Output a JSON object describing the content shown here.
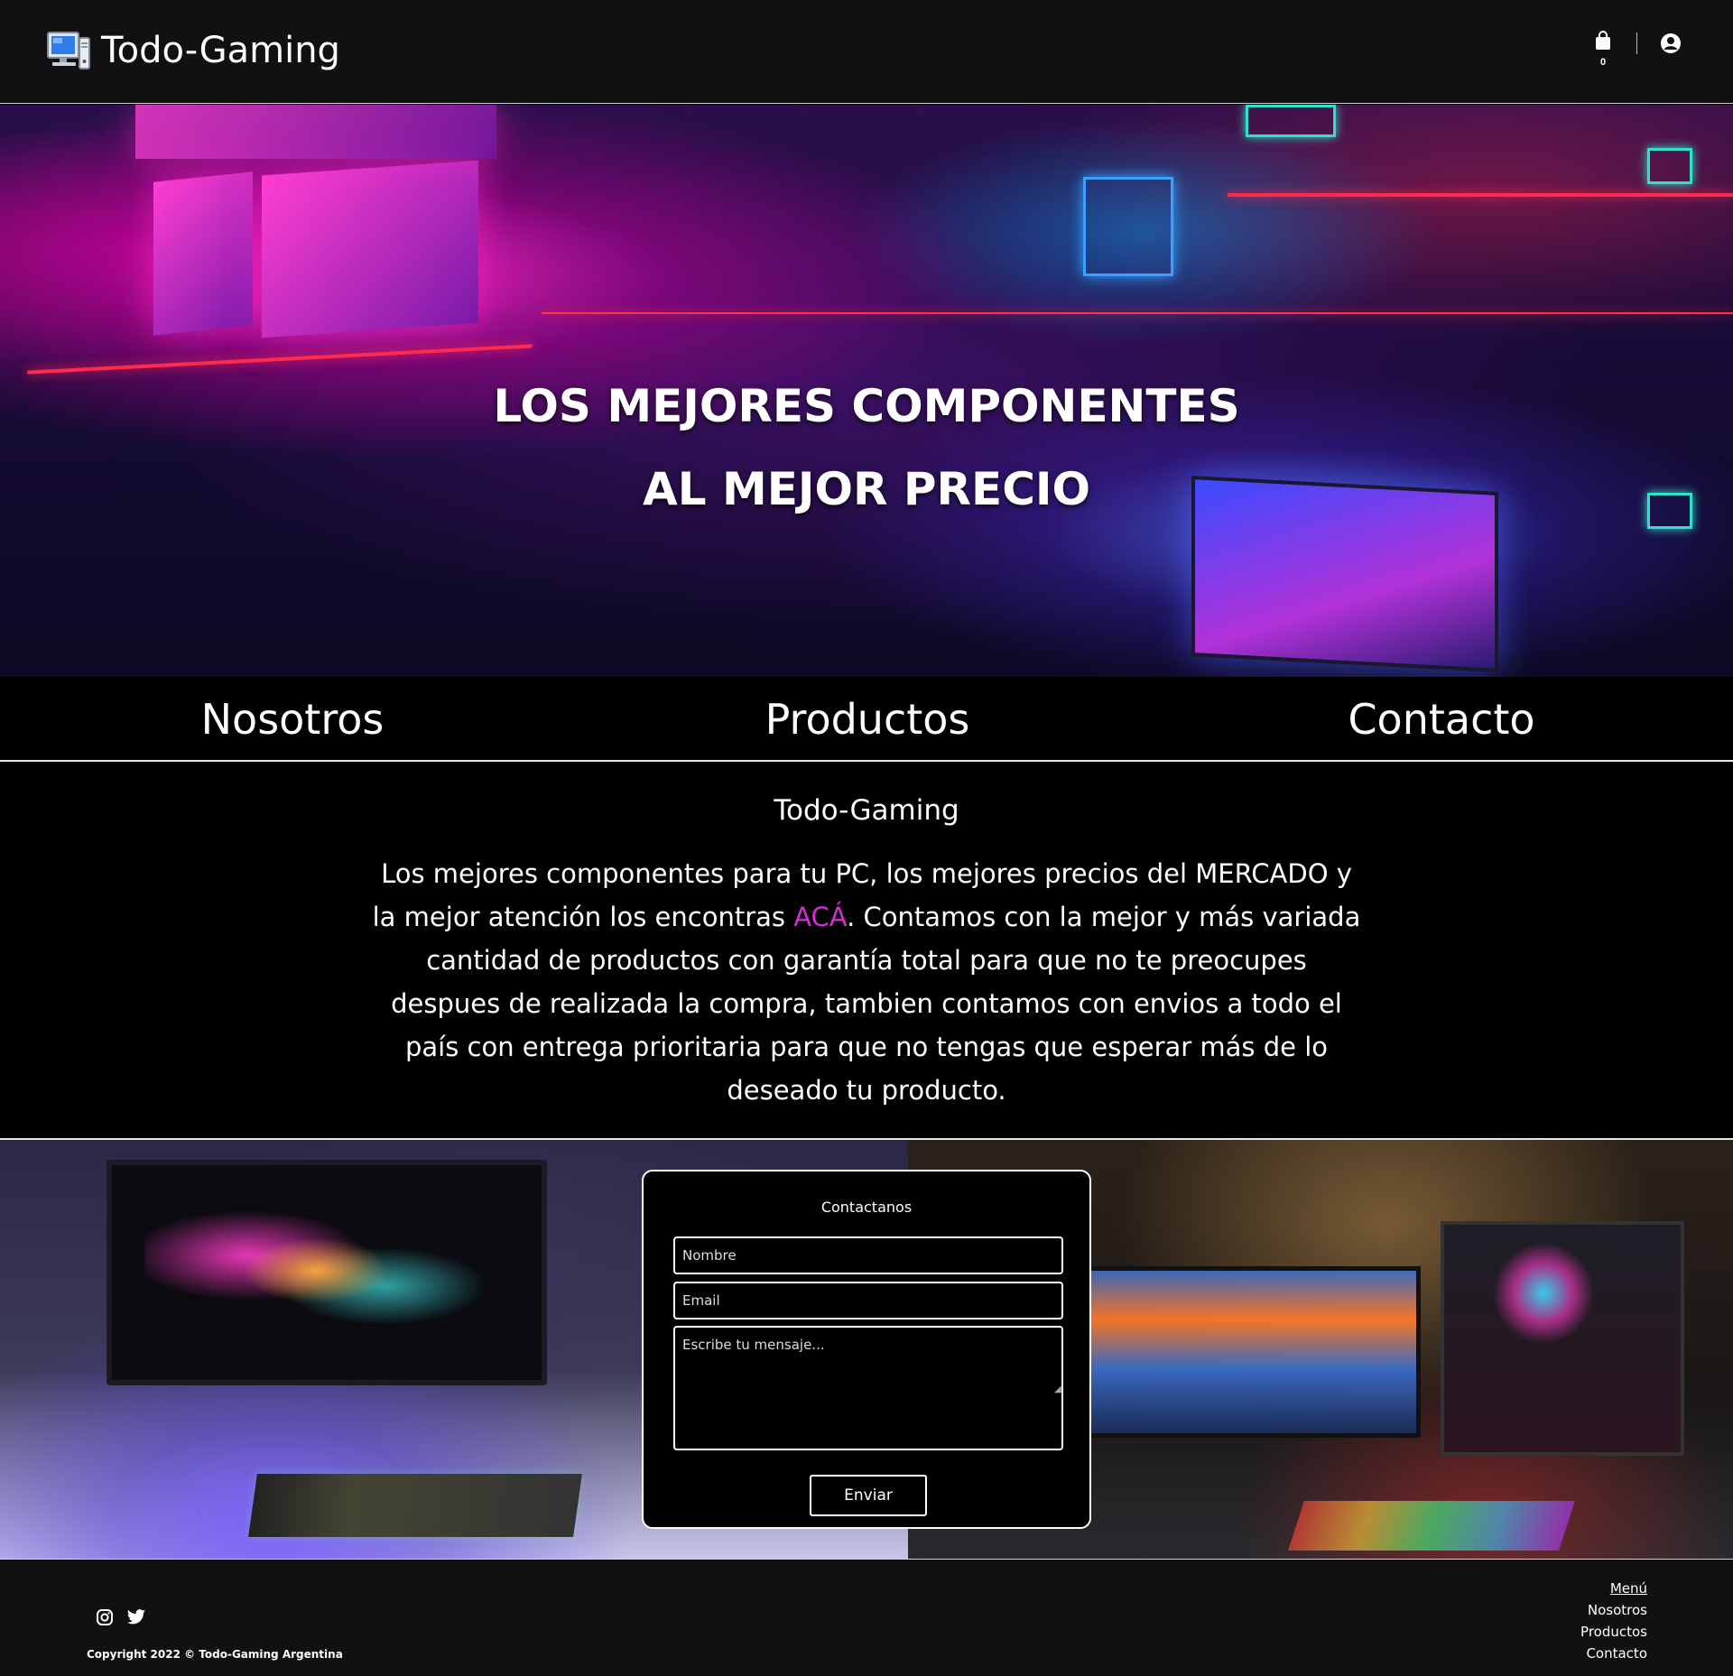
{
  "header": {
    "brand_name": "Todo-Gaming",
    "cart_count": "0",
    "icons": [
      "computer-logo-icon",
      "shopping-bag-icon",
      "user-circle-icon"
    ]
  },
  "hero": {
    "line1": "LOS MEJORES COMPONENTES",
    "line2": "AL MEJOR PRECIO"
  },
  "nav": {
    "items": [
      "Nosotros",
      "Productos",
      "Contacto"
    ]
  },
  "about": {
    "title": "Todo-Gaming",
    "text_before": "Los mejores componentes para tu PC, los mejores precios del MERCADO y la mejor atención los encontras ",
    "highlight": "ACÁ",
    "text_after": ". Contamos con la mejor y más variada cantidad de productos con garantía total para que no te preocupes despues de realizada la compra, tambien contamos con envios a todo el país con entrega prioritaria para que no tengas que esperar más de lo deseado tu producto."
  },
  "contact_form": {
    "title": "Contactanos",
    "name_placeholder": "Nombre",
    "email_placeholder": "Email",
    "message_placeholder": "Escribe tu mensaje...",
    "submit_label": "Enviar"
  },
  "footer": {
    "copyright": "Copyright 2022 © Todo-Gaming Argentina",
    "menu_title": "Menú",
    "menu_items": [
      "Nosotros",
      "Productos",
      "Contacto"
    ],
    "social_icons": [
      "instagram-icon",
      "twitter-icon"
    ]
  },
  "colors": {
    "accent": "#d12fd1",
    "background": "#000000",
    "header_bg": "#111111"
  }
}
